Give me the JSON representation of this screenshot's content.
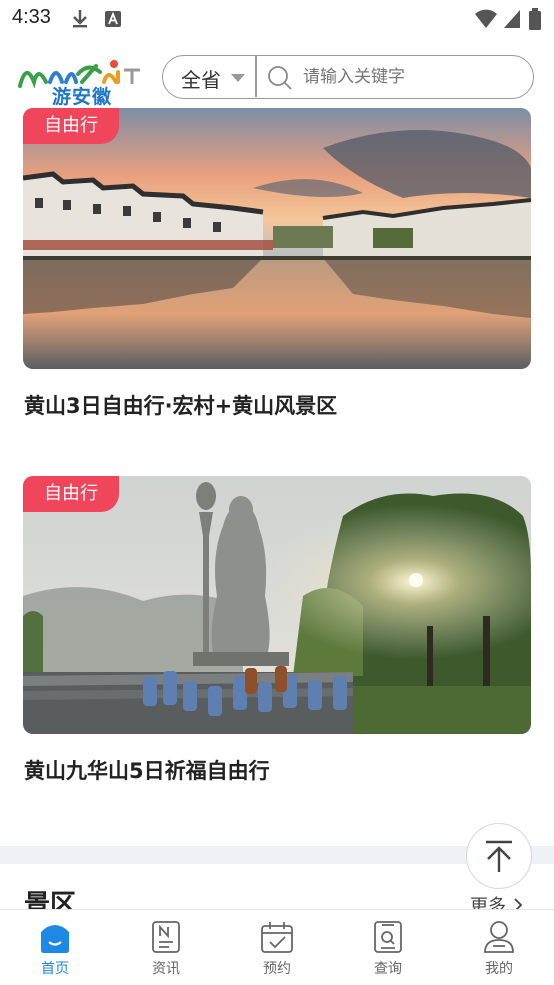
{
  "status_bar": {
    "time": "4:33"
  },
  "header": {
    "logo_text": "游安徽",
    "region_label": "全省",
    "search_placeholder": "请输入关键字"
  },
  "cards": [
    {
      "badge": "自由行",
      "title": "黄山3日自由行·宏村+黄山风景区"
    },
    {
      "badge": "自由行",
      "title": "黄山九华山5日祈福自由行"
    }
  ],
  "section": {
    "title": "景区",
    "more_label": "更多"
  },
  "tabbar": {
    "items": [
      {
        "label": "首页",
        "icon": "home-icon",
        "active": true
      },
      {
        "label": "资讯",
        "icon": "news-icon",
        "active": false
      },
      {
        "label": "预约",
        "icon": "calendar-icon",
        "active": false
      },
      {
        "label": "查询",
        "icon": "query-icon",
        "active": false
      },
      {
        "label": "我的",
        "icon": "profile-icon",
        "active": false
      }
    ]
  },
  "colors": {
    "accent": "#1e88e5",
    "badge": "#f0455a"
  }
}
